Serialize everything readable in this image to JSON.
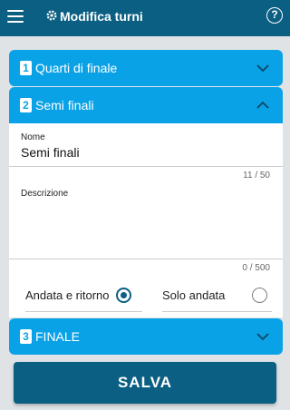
{
  "appbar": {
    "title": "Modifica turni",
    "menu_icon": "hamburger-menu-icon",
    "title_icon": "cog-icon",
    "help_icon": "help-circle-icon",
    "help_glyph": "?"
  },
  "panels": [
    {
      "number": "1",
      "title": "Quarti di finale",
      "expanded": false
    },
    {
      "number": "2",
      "title": "Semi finali",
      "expanded": true
    },
    {
      "number": "3",
      "title": "FINALE",
      "expanded": false
    }
  ],
  "form": {
    "name_label": "Nome",
    "name_value": "Semi finali",
    "name_counter": "11 / 50",
    "description_label": "Descrizione",
    "description_value": "",
    "description_counter": "0 / 500",
    "radio_options": [
      {
        "label": "Andata e ritorno",
        "checked": true
      },
      {
        "label": "Solo andata",
        "checked": false
      }
    ]
  },
  "save_label": "SALVA",
  "colors": {
    "appbar": "#0a5f82",
    "panel_header": "#0aa2e6",
    "background": "#dfe3e6",
    "save_button": "#0a5f82"
  }
}
